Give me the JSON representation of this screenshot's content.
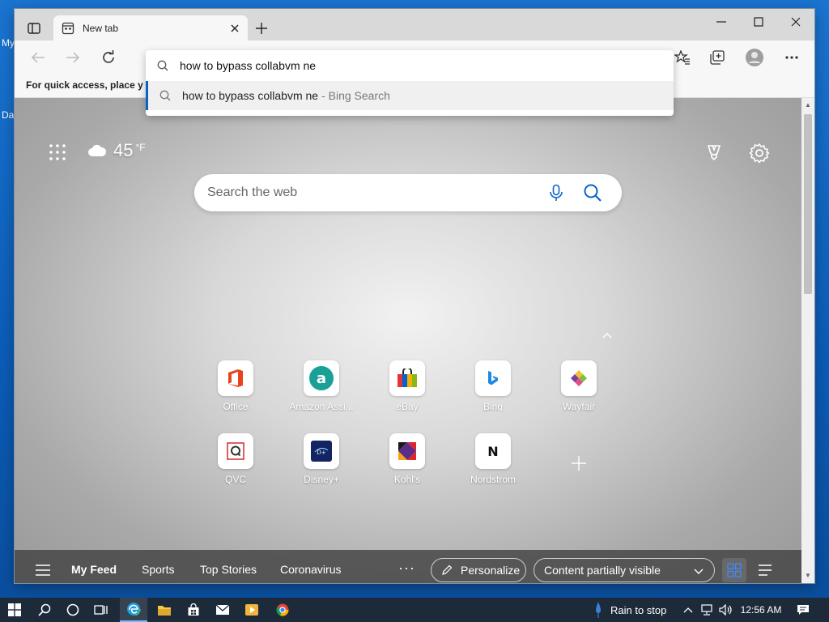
{
  "desktop": {
    "icon_label_1": "My",
    "icon_label_2": "Da"
  },
  "window": {
    "tab_title": "New tab",
    "favorites_bar_text": "For quick access, place y"
  },
  "omnibox": {
    "value": "how to bypass collabvm ne",
    "suggestion_text": "how to bypass collabvm ne",
    "suggestion_source": "- Bing Search"
  },
  "newtab": {
    "weather_temp": "45",
    "weather_unit": "°F",
    "search_placeholder": "Search the web",
    "tiles": [
      {
        "label": "Office"
      },
      {
        "label": "Amazon Assi..."
      },
      {
        "label": "eBay"
      },
      {
        "label": "Bing"
      },
      {
        "label": "Wayfair"
      },
      {
        "label": "QVC"
      },
      {
        "label": "Disney+"
      },
      {
        "label": "Kohl's"
      },
      {
        "label": "Nordstrom"
      }
    ],
    "tile_icons": [
      "office-logo",
      "amazon-assistant-logo",
      "ebay-logo",
      "bing-logo",
      "wayfair-logo",
      "qvc-logo",
      "disney-plus-logo",
      "kohls-logo",
      "nordstrom-logo"
    ]
  },
  "feed": {
    "tabs": [
      "My Feed",
      "Sports",
      "Top Stories",
      "Coronavirus"
    ],
    "personalize_label": "Personalize",
    "visibility_label": "Content partially visible"
  },
  "taskbar": {
    "weather_text": "Rain to stop",
    "time": "12:56 AM"
  },
  "colors": {
    "accent": "#0a64c8",
    "taskbar": "#1d2a3a"
  }
}
